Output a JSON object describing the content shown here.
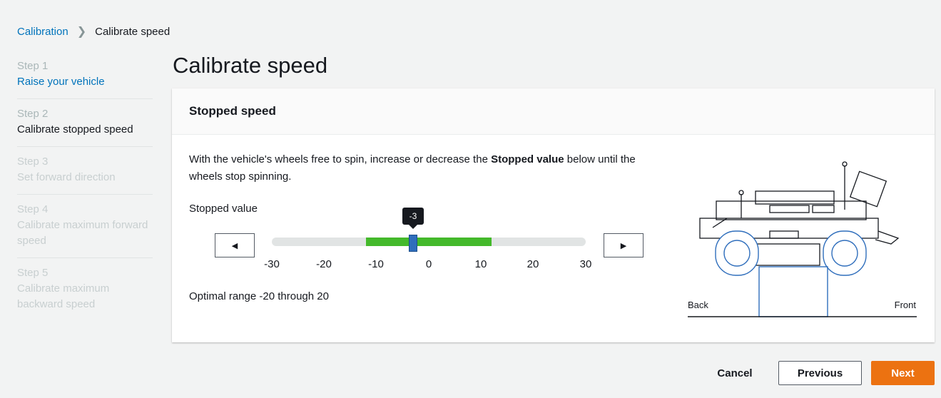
{
  "breadcrumb": {
    "root": "Calibration",
    "current": "Calibrate speed"
  },
  "steps": [
    {
      "num": "Step 1",
      "title": "Raise your vehicle",
      "state": "link"
    },
    {
      "num": "Step 2",
      "title": "Calibrate stopped speed",
      "state": "active"
    },
    {
      "num": "Step 3",
      "title": "Set forward direction",
      "state": "disabled"
    },
    {
      "num": "Step 4",
      "title": "Calibrate maximum forward speed",
      "state": "disabled"
    },
    {
      "num": "Step 5",
      "title": "Calibrate maximum backward speed",
      "state": "disabled"
    }
  ],
  "page_title": "Calibrate speed",
  "panel": {
    "header": "Stopped speed",
    "desc_before": "With the vehicle's wheels free to spin, increase or decrease the ",
    "desc_bold": "Stopped value",
    "desc_after": " below until the wheels stop spinning.",
    "field_label": "Stopped value",
    "slider": {
      "min": -30,
      "max": 30,
      "value": -3,
      "value_label": "-3",
      "highlight_range": [
        -12,
        12
      ],
      "ticks": [
        "-30",
        "-20",
        "-10",
        "0",
        "10",
        "20",
        "30"
      ]
    },
    "decrement_icon": "left-triangle-icon",
    "increment_icon": "right-triangle-icon",
    "optimal_text": "Optimal range -20 through 20",
    "illustration": {
      "back_label": "Back",
      "front_label": "Front"
    }
  },
  "footer": {
    "cancel": "Cancel",
    "previous": "Previous",
    "next": "Next"
  },
  "colors": {
    "accent": "#0073bb",
    "primary_button": "#ec7211",
    "range_green": "#44b92b",
    "thumb": "#2f6ebc"
  }
}
